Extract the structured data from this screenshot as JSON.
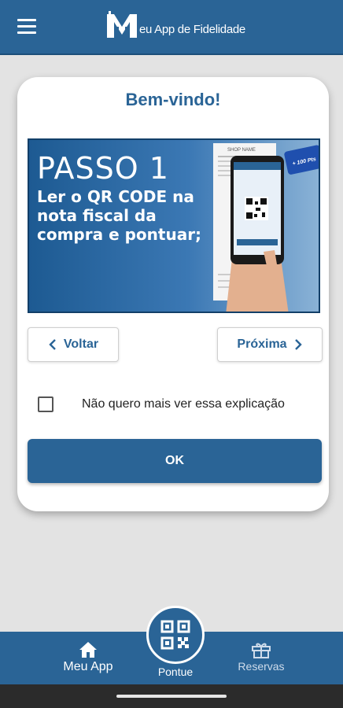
{
  "header": {
    "menu_icon": "hamburger-menu-icon",
    "logo_letter": "M",
    "app_name": "eu App de Fidelidade"
  },
  "dialog": {
    "title": "Bem-vindo!",
    "banner": {
      "step": "PASSO 1",
      "text": "Ler o QR CODE na nota fiscal da compra e pontuar;",
      "badge": "+ 100 Pts",
      "receipt_header": "SHOP NAME"
    },
    "back_label": "Voltar",
    "next_label": "Próxima",
    "checkbox_label": "Não quero mais ver essa explicação",
    "checkbox_checked": false,
    "ok_label": "OK"
  },
  "bottom_nav": {
    "items": [
      {
        "label": "Meu App",
        "icon": "home-icon"
      },
      {
        "label": "Pontue",
        "icon": "qr-code-icon"
      },
      {
        "label": "Reservas",
        "icon": "gift-icon"
      }
    ]
  },
  "colors": {
    "primary": "#2a6496",
    "background": "#e3e3e3",
    "card": "#ffffff"
  }
}
